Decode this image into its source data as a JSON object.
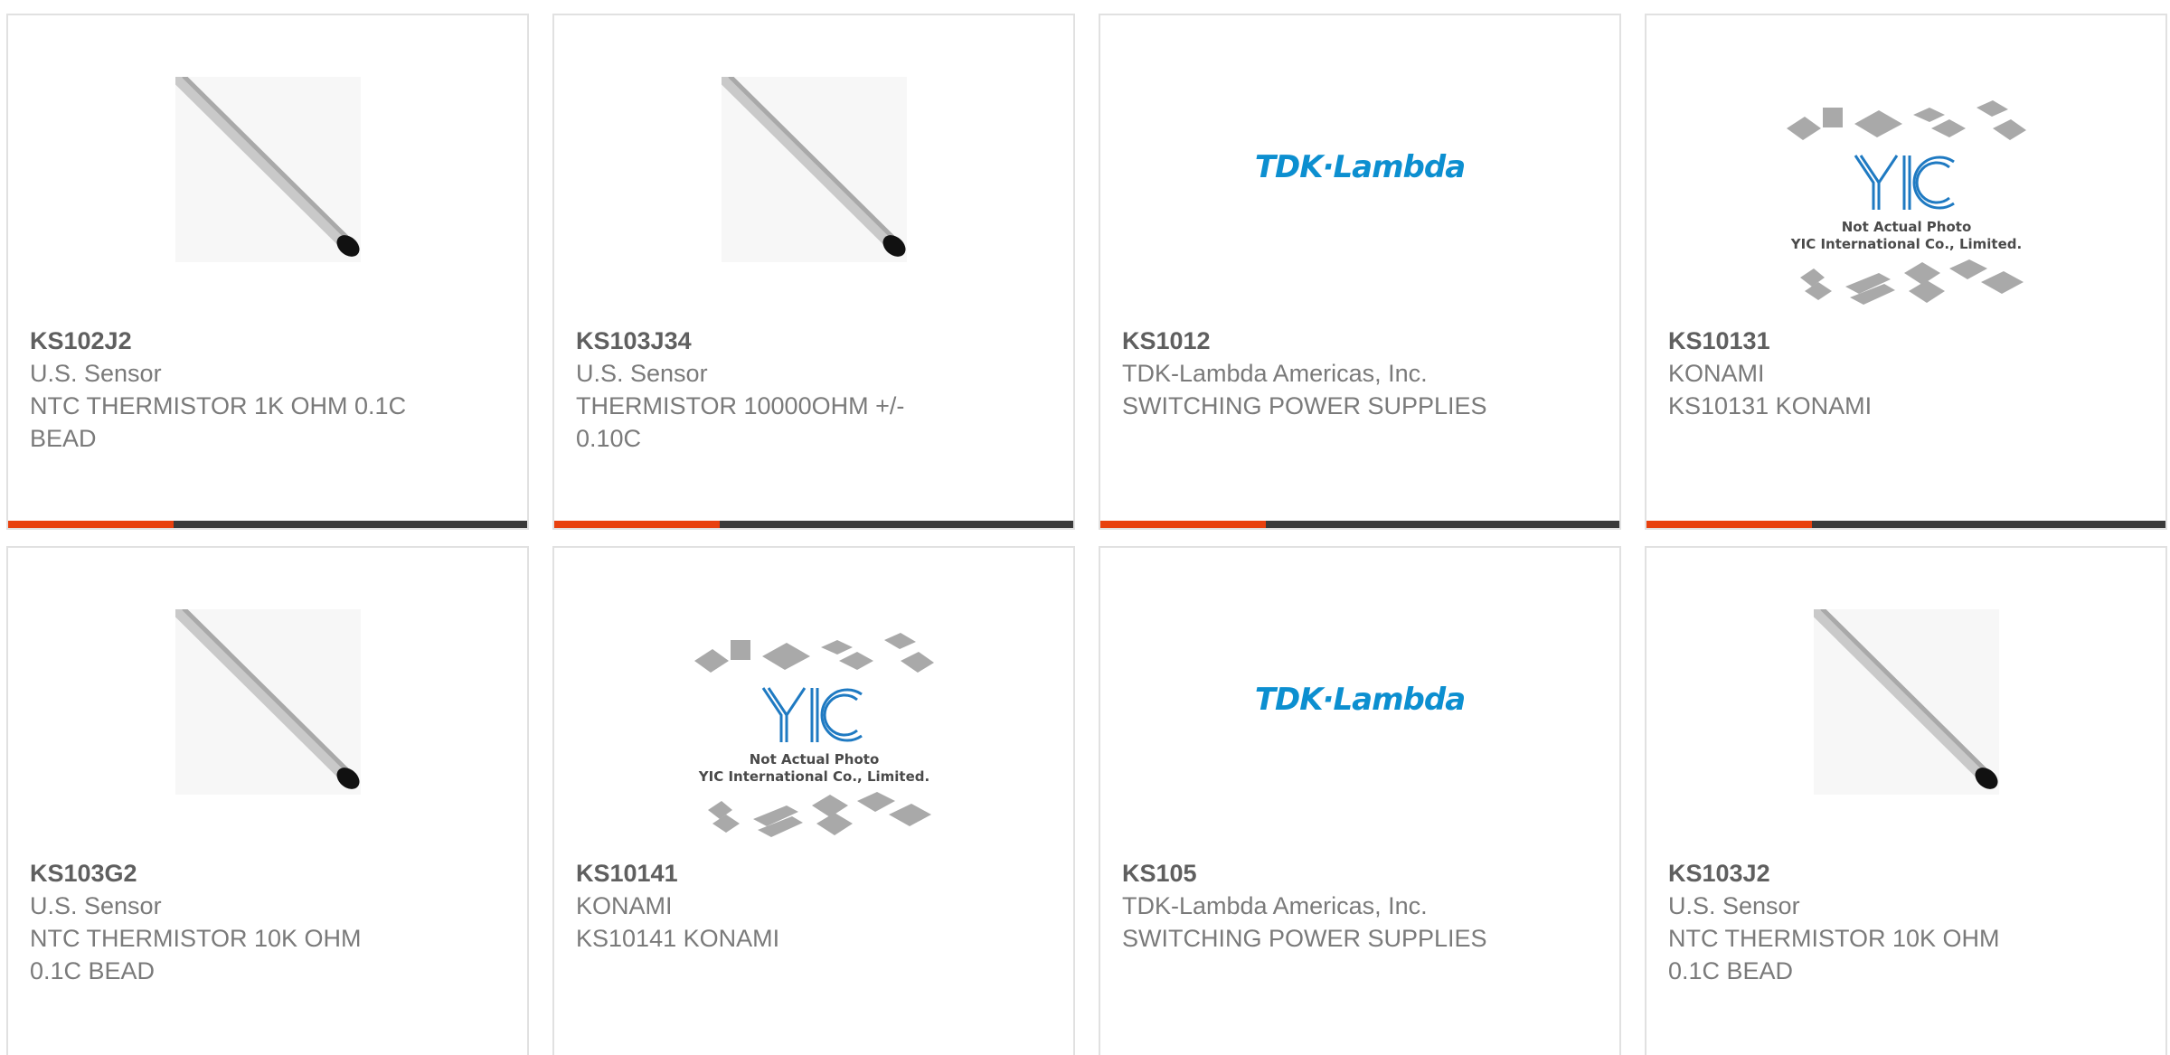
{
  "colors": {
    "accent": "#e8410f",
    "bar_dark": "#3a3a3a",
    "tdk_blue": "#0c8fd0",
    "yic_blue": "#1f7ac2"
  },
  "products": [
    {
      "part": "KS102J2",
      "manufacturer": "U.S. Sensor",
      "description": "NTC THERMISTOR 1K OHM 0.1C BEAD",
      "image": "thermistor-image"
    },
    {
      "part": "KS103J34",
      "manufacturer": "U.S. Sensor",
      "description": "THERMISTOR 10000OHM +/- 0.10C",
      "image": "thermistor-image"
    },
    {
      "part": "KS1012",
      "manufacturer": "TDK-Lambda Americas, Inc.",
      "description": "SWITCHING POWER SUPPLIES",
      "image": "tdk-lambda-logo"
    },
    {
      "part": "KS10131",
      "manufacturer": "KONAMI",
      "description": "KS10131 KONAMI",
      "image": "yic-placeholder-image"
    },
    {
      "part": "KS103G2",
      "manufacturer": "U.S. Sensor",
      "description": "NTC THERMISTOR 10K OHM 0.1C BEAD",
      "image": "thermistor-image"
    },
    {
      "part": "KS10141",
      "manufacturer": "KONAMI",
      "description": "KS10141 KONAMI",
      "image": "yic-placeholder-image"
    },
    {
      "part": "KS105",
      "manufacturer": "TDK-Lambda Americas, Inc.",
      "description": "SWITCHING POWER SUPPLIES",
      "image": "tdk-lambda-logo"
    },
    {
      "part": "KS103J2",
      "manufacturer": "U.S. Sensor",
      "description": "NTC THERMISTOR 10K OHM 0.1C BEAD",
      "image": "thermistor-image"
    }
  ],
  "logos": {
    "tdk": "TDK·Lambda",
    "yic_line1": "Not Actual Photo",
    "yic_line2": "YIC International Co., Limited."
  }
}
